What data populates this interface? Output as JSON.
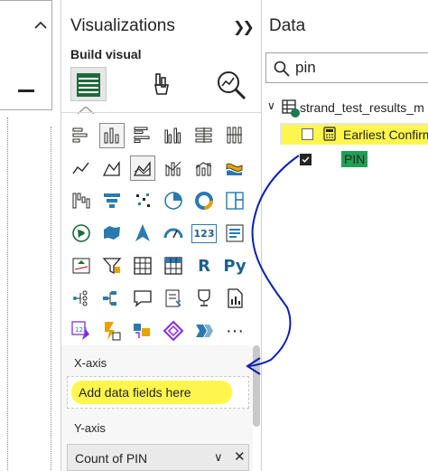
{
  "visualizations": {
    "title": "Visualizations",
    "collapse_icon": "double-chevron-right",
    "build_label": "Build visual",
    "tabs": [
      {
        "name": "build-visual-tab",
        "icon": "table-grid-icon",
        "selected": true
      },
      {
        "name": "format-visual-tab",
        "icon": "paintbrush-icon"
      },
      {
        "name": "analytics-tab",
        "icon": "magnifier-chart-icon"
      }
    ],
    "visual_types": [
      "stacked-bar",
      "stacked-column",
      "clustered-bar",
      "clustered-column",
      "100-stacked-bar",
      "100-stacked-column",
      "line",
      "area",
      "stacked-area",
      "line-clustered-column",
      "line-stacked-column",
      "ribbon",
      "waterfall",
      "funnel",
      "scatter",
      "pie",
      "donut",
      "treemap",
      "map",
      "filled-map",
      "azure-map",
      "gauge",
      "card",
      "multi-row-card",
      "kpi",
      "slicer",
      "table",
      "matrix",
      "r-visual",
      "python-visual",
      "key-influencers",
      "decomposition-tree",
      "qa",
      "smart-narrative",
      "metrics",
      "paginated-report",
      "power-apps",
      "power-automate",
      "custom-visual-a",
      "custom-visual-b",
      "custom-visual-c",
      "more"
    ],
    "text_icons": {
      "r": "R",
      "py": "Py",
      "more": "···",
      "card": "123"
    },
    "x_axis_label": "X-axis",
    "x_axis_placeholder": "Add data fields here",
    "y_axis_label": "Y-axis",
    "y_axis_field": "Count of PIN"
  },
  "data": {
    "title": "Data",
    "search_value": "pin",
    "table_name": "strand_test_results_m",
    "fields": [
      {
        "name": "Earliest Confirm",
        "checked": false,
        "type": "calc"
      },
      {
        "name": "PIN",
        "checked": true,
        "type": "text"
      }
    ]
  },
  "colors": {
    "highlight": "#fff64d",
    "accent_green": "#1d7a4a",
    "annotation_blue": "#0b1fb3"
  }
}
